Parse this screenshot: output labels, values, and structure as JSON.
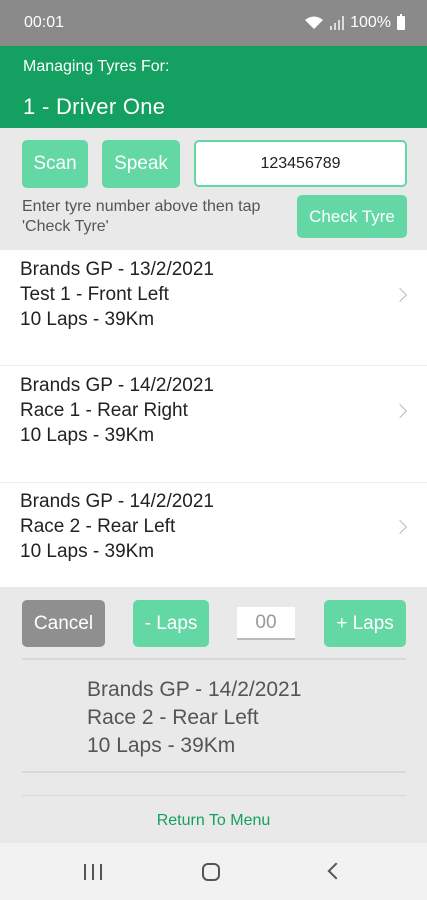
{
  "status": {
    "time": "00:01",
    "battery": "100%",
    "icons": [
      "wifi-icon",
      "signal-icon",
      "battery-icon"
    ]
  },
  "header": {
    "subtitle": "Managing Tyres For:",
    "driver": "1  -  Driver One"
  },
  "search": {
    "scan_label": "Scan",
    "speak_label": "Speak",
    "tyre_number": "123456789",
    "hint": "Enter tyre number above then tap 'Check Tyre'",
    "check_label": "Check Tyre"
  },
  "history": [
    {
      "event": "Brands GP  -  13/2/2021",
      "session": "Test 1  -  Front Left",
      "distance": "10  Laps  -  39Km"
    },
    {
      "event": "Brands GP  -  14/2/2021",
      "session": "Race 1  -  Rear Right",
      "distance": "10  Laps  -  39Km"
    },
    {
      "event": "Brands GP  -  14/2/2021",
      "session": "Race 2  -  Rear Left",
      "distance": "10  Laps  -  39Km"
    }
  ],
  "controls": {
    "cancel_label": "Cancel",
    "minus_label": "- Laps",
    "laps_value": "00",
    "plus_label": "+ Laps"
  },
  "selected": {
    "event": "Brands GP  -  14/2/2021",
    "session": "Race 2  -  Rear Left",
    "distance": "10  Laps  -  39Km"
  },
  "footer": {
    "return_label": "Return To Menu"
  },
  "colors": {
    "brand_green": "#14a060",
    "button_green": "#63d7a4",
    "cancel_gray": "#8f8f8f"
  }
}
